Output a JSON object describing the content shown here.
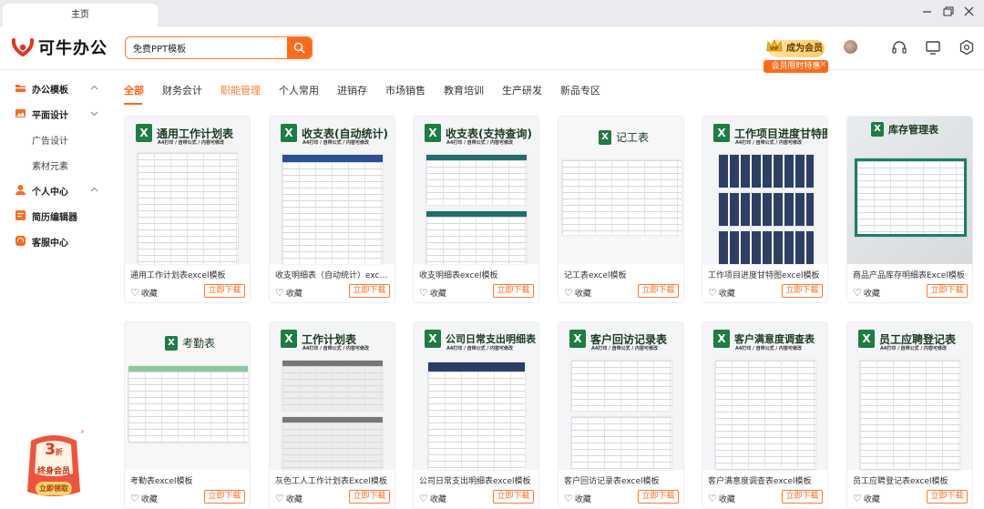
{
  "window": {
    "tab_title": "主页"
  },
  "header": {
    "logo_text": "可牛办公",
    "search_value": "免费PPT模板",
    "vip_button": "成为会员",
    "vip_promo": "会员限时特惠",
    "vip_promo_close": "×"
  },
  "sidebar": {
    "items": [
      {
        "label": "办公模板",
        "icon": "folder-icon",
        "chevron": "︿"
      },
      {
        "label": "平面设计",
        "icon": "image-icon",
        "chevron": "﹀"
      },
      {
        "label": "广告设计"
      },
      {
        "label": "素材元素"
      },
      {
        "label": "个人中心",
        "icon": "user-icon",
        "chevron": "︿"
      },
      {
        "label": "简历编辑器",
        "icon": "resume-icon"
      },
      {
        "label": "客服中心",
        "icon": "headset-icon"
      }
    ],
    "promo": {
      "discount": "3",
      "discount_unit": "折",
      "title": "终身会员",
      "button": "立即领取"
    }
  },
  "categories": [
    "全部",
    "财务会计",
    "职能管理",
    "个人常用",
    "进销存",
    "市场销售",
    "教育培训",
    "生产研发",
    "新品专区"
  ],
  "card_common": {
    "fav_label": "收藏",
    "download_label": "立即下载",
    "subtitle": "A4打印 / 自带公式 / 内容可修改"
  },
  "cards": [
    {
      "thumb_title": "通用工作计划表",
      "title": "通用工作计划表excel模板"
    },
    {
      "thumb_title": "收支表(自动统计)",
      "title": "收支明细表（自动统计）excel模板"
    },
    {
      "thumb_title": "收支表(支持查询)",
      "title": "收支明细表excel模板"
    },
    {
      "thumb_title": "记工表",
      "title": "记工表excel模板"
    },
    {
      "thumb_title": "工作项目进度甘特图",
      "title": "工作项目进度甘特图excel模板"
    },
    {
      "thumb_title": "库存管理表",
      "title": "商品产品库存明细表Excel模板"
    },
    {
      "thumb_title": "考勤表",
      "title": "考勤表excel模板"
    },
    {
      "thumb_title": "工作计划表",
      "title": "灰色工人工作计划表Excel模板"
    },
    {
      "thumb_title": "公司日常支出明细表",
      "title": "公司日常支出明细表excel模板"
    },
    {
      "thumb_title": "客户回访记录表",
      "title": "客户回访记录表excel模板"
    },
    {
      "thumb_title": "客户满意度调查表",
      "title": "客户满意度调查表excel模板"
    },
    {
      "thumb_title": "员工应聘登记表",
      "title": "员工应聘登记表excel模板"
    }
  ],
  "colors": {
    "accent": "#ff6a1a",
    "excel_green": "#1e7c45"
  }
}
